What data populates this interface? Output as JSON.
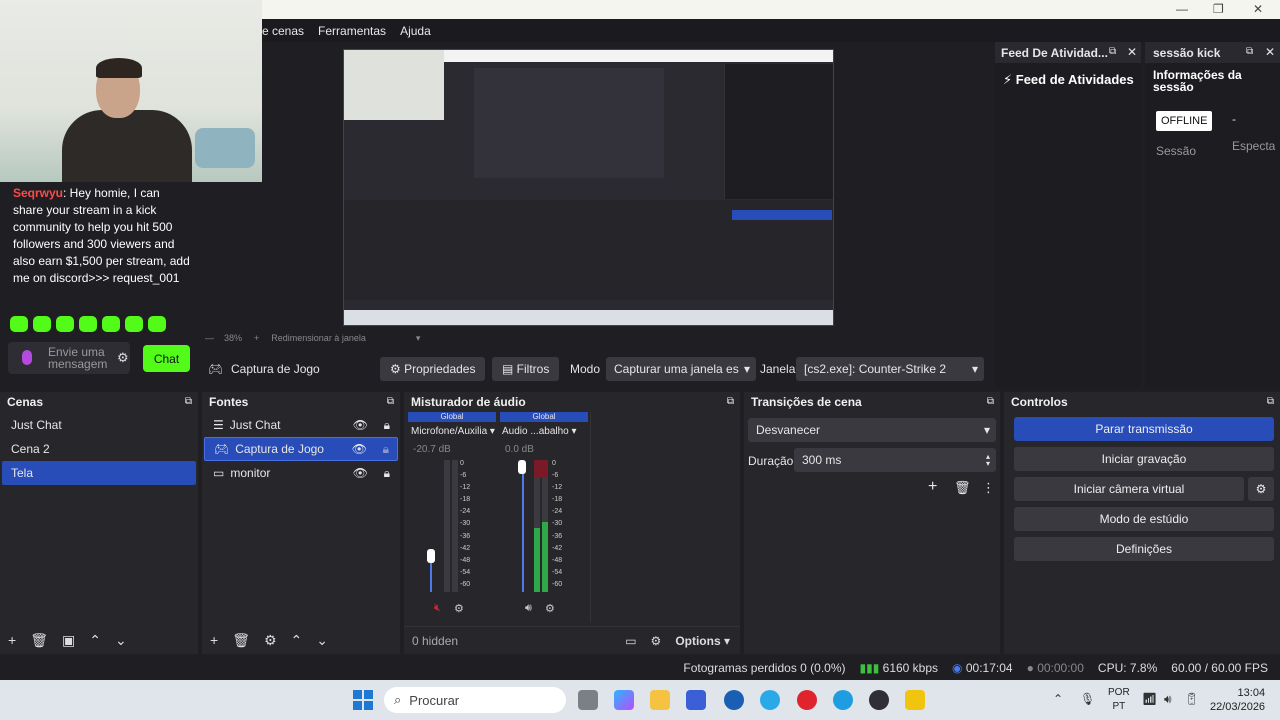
{
  "menu": [
    "e cenas",
    "Ferramentas",
    "Ajuda"
  ],
  "window_controls": [
    "—",
    "❐",
    "✕"
  ],
  "chat": {
    "username": "Seqrwyu",
    "message": ": Hey homie, I can share your stream in a kick community to help you hit 500 followers and 300 viewers and also earn $1,500 per stream, add me on discord>>> request_001",
    "input_placeholder": "Envie uma mensagem",
    "send_label": "Chat"
  },
  "feed": {
    "dock_title": "Feed De Atividad...",
    "title": "Feed de Atividades"
  },
  "session": {
    "dock_title": "sessão kick",
    "title": "Informações da sessão",
    "badge": "OFFLINE",
    "dash": "-",
    "label_session": "Sessão",
    "label_spect": "Especta"
  },
  "preview_status": {
    "zoom": "38%",
    "resize": "Redimensionar à janela"
  },
  "source_toolbar": {
    "source_name": "Captura de Jogo",
    "properties": "Propriedades",
    "filters": "Filtros",
    "mode_label": "Modo",
    "mode_value": "Capturar uma janela es",
    "window_label": "Janela",
    "window_value": "[cs2.exe]: Counter-Strike 2"
  },
  "scenes": {
    "title": "Cenas",
    "items": [
      "Just Chat",
      "Cena 2",
      "Tela"
    ],
    "selected": 2
  },
  "sources": {
    "title": "Fontes",
    "items": [
      "Just Chat",
      "Captura de Jogo",
      "monitor"
    ],
    "selected": 1
  },
  "mixer": {
    "title": "Misturador de áudio",
    "channels": [
      {
        "tag": "Global",
        "name": "Microfone/Auxilia",
        "db": "-20.7 dB",
        "level": 0.25
      },
      {
        "tag": "Global",
        "name": "Áudio ...abalho",
        "db": "0.0 dB",
        "level": 1.0
      }
    ],
    "scale": [
      "0",
      "-6",
      "-12",
      "-18",
      "-24",
      "-30",
      "-36",
      "-42",
      "-48",
      "-54",
      "-60"
    ],
    "hidden": "0 hidden",
    "options": "Options"
  },
  "transitions": {
    "title": "Transições de cena",
    "selected": "Desvanecer",
    "duration_label": "Duração",
    "duration_value": "300 ms"
  },
  "controls": {
    "title": "Controlos",
    "buttons": [
      "Parar transmissão",
      "Iniciar gravação",
      "Iniciar câmera virtual",
      "Modo de estúdio",
      "Definições"
    ]
  },
  "status": {
    "frames": "Fotogramas perdidos 0 (0.0%)",
    "bitrate": "6160 kbps",
    "stream_time": "00:17:04",
    "rec_time": "00:00:00",
    "cpu": "CPU: 7.8%",
    "fps": "60.00 / 60.00 FPS"
  },
  "taskbar": {
    "search": "Procurar",
    "lang1": "POR",
    "lang2": "PT",
    "time": "13:04",
    "date": "22/03/2026"
  },
  "colors": {
    "accent": "#284cb8",
    "kick_green": "#53fc18",
    "chat_user": "#ff4a4a"
  }
}
